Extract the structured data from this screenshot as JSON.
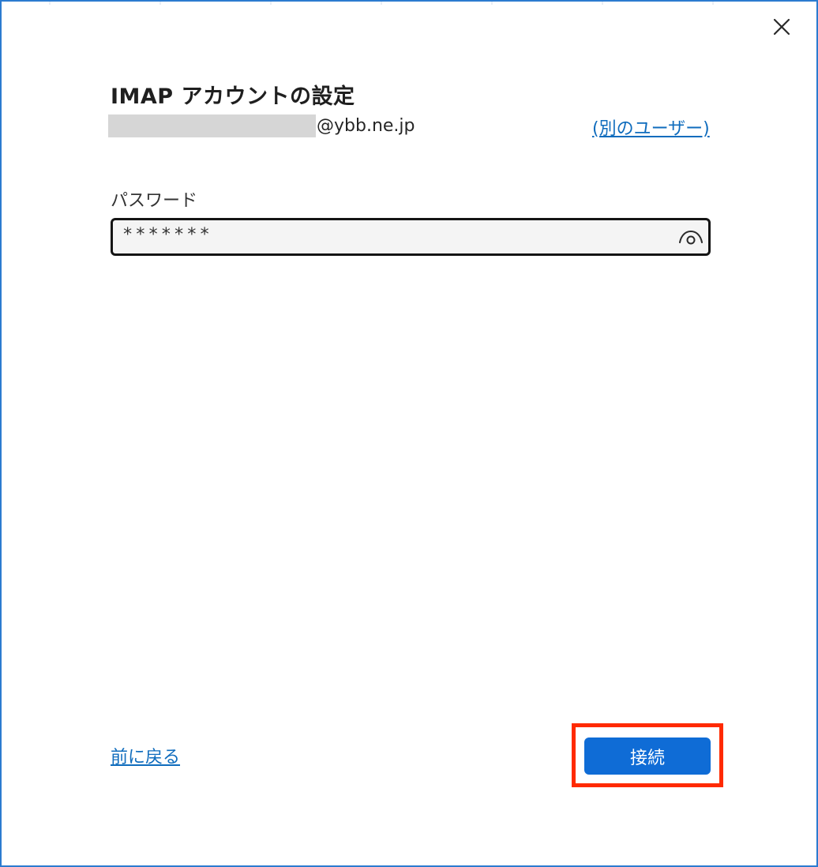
{
  "dialog": {
    "title": "IMAP アカウントの設定",
    "email_domain": "@ybb.ne.jp",
    "switch_user_label": "(別のユーザー)",
    "password_label": "パスワード",
    "password_value": "*******",
    "back_label": "前に戻る",
    "connect_label": "接続"
  },
  "icons": {
    "close": "close-icon",
    "reveal_password": "eye-icon"
  },
  "colors": {
    "border": "#2b7bd0",
    "link": "#0f6cbd",
    "primary_button": "#0f6cd6",
    "highlight": "#ff2a00",
    "field_background": "#f4f4f4"
  }
}
